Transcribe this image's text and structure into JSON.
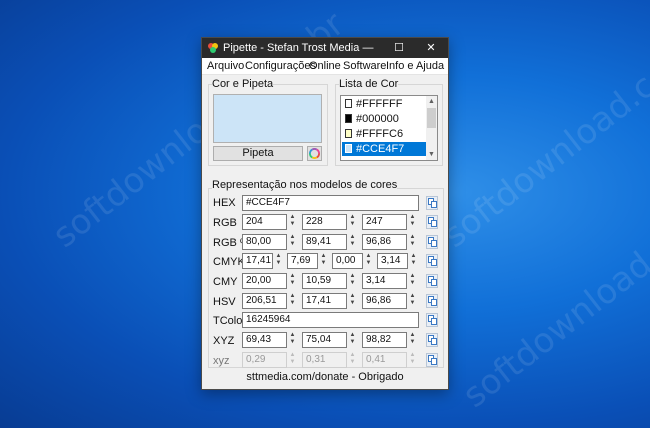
{
  "window": {
    "title": "Pipette - Stefan Trost Media",
    "controls": {
      "minimize": "—",
      "maximize": "☐",
      "close": "✕"
    }
  },
  "menu": [
    "Arquivo",
    "Configurações",
    "Online",
    "Software",
    "Info e Ajuda"
  ],
  "cor_pipeta": {
    "group_label": "Cor e Pipeta",
    "preview_color": "#CCE4F7",
    "pipeta_button": "Pipeta"
  },
  "lista_cor": {
    "group_label": "Lista de Cor",
    "items": [
      {
        "label": "#FFFFFF",
        "color": "#FFFFFF",
        "selected": false
      },
      {
        "label": "#000000",
        "color": "#000000",
        "selected": false
      },
      {
        "label": "#FFFFC6",
        "color": "#FFFFC6",
        "selected": false
      },
      {
        "label": "#CCE4F7",
        "color": "#CCE4F7",
        "selected": true
      }
    ]
  },
  "models": {
    "group_label": "Representação nos modelos de cores",
    "hex": {
      "label": "HEX",
      "value": "#CCE4F7"
    },
    "rgb": {
      "label": "RGB",
      "values": [
        "204",
        "228",
        "247"
      ]
    },
    "rgb_pct": {
      "label": "RGB %",
      "values": [
        "80,00",
        "89,41",
        "96,86"
      ]
    },
    "cmyk": {
      "label": "CMYK",
      "values": [
        "17,41",
        "7,69",
        "0,00",
        "3,14"
      ]
    },
    "cmy": {
      "label": "CMY",
      "values": [
        "20,00",
        "10,59",
        "3,14"
      ]
    },
    "hsv": {
      "label": "HSV",
      "values": [
        "206,51",
        "17,41",
        "96,86"
      ]
    },
    "tcolor": {
      "label": "TColor",
      "value": "16245964"
    },
    "xyz": {
      "label": "XYZ",
      "values": [
        "69,43",
        "75,04",
        "98,82"
      ]
    },
    "xyz_lower": {
      "label": "xyz",
      "values": [
        "0,29",
        "0,31",
        "0,41"
      ]
    }
  },
  "footer": "sttmedia.com/donate - Obrigado",
  "desktop_watermark": "softdownload.com.br"
}
